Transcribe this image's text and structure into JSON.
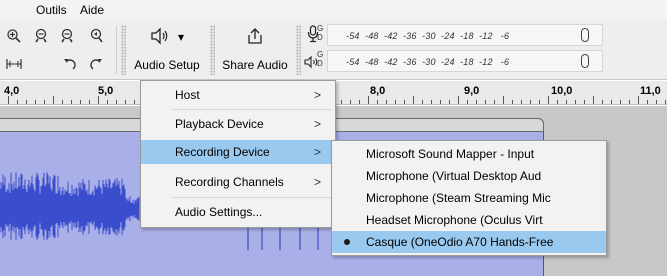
{
  "menubar": {
    "items": [
      {
        "label": "Outils"
      },
      {
        "label": "Aide"
      }
    ]
  },
  "toolbar": {
    "audio_setup_label": "Audio Setup",
    "share_audio_label": "Share Audio",
    "dropdown_glyph": "▾"
  },
  "meters": {
    "record": {
      "channels": "G\nD",
      "scale": "-54  -48  -42  -36  -30  -24  -18  -12   -6"
    },
    "playback": {
      "channels": "G\nD",
      "scale": "-54  -48  -42  -36  -30  -24  -18  -12   -6"
    }
  },
  "ruler": {
    "labels": [
      "4,0",
      "5,0",
      "8,0",
      "9,0",
      "10,0",
      "11,0"
    ]
  },
  "audio_setup_menu": {
    "items": [
      {
        "label": "Host",
        "submenu": true
      },
      {
        "label": "Playback Device",
        "submenu": true
      },
      {
        "label": "Recording Device",
        "submenu": true,
        "highlighted": true
      },
      {
        "label": "Recording Channels",
        "submenu": true
      },
      {
        "label": "Audio Settings...",
        "submenu": false
      }
    ],
    "arrow_glyph": ">"
  },
  "recording_device_menu": {
    "items": [
      {
        "label": "Microsoft Sound Mapper - Input",
        "selected": false
      },
      {
        "label": "Microphone (Virtual Desktop Aud",
        "selected": false
      },
      {
        "label": "Microphone (Steam Streaming Mic",
        "selected": false
      },
      {
        "label": "Headset Microphone (Oculus Virt",
        "selected": false
      },
      {
        "label": "Casque (OneOdio A70 Hands-Free",
        "selected": true
      }
    ]
  },
  "colors": {
    "highlight": "#99c9ef",
    "waveform": "#3a4dcc",
    "clip_background": "#a9b0e8",
    "track_background": "#c8c8c8"
  },
  "icons": [
    "zoom-in-icon",
    "zoom-out-icon",
    "zoom-selection-icon",
    "zoom-fit-icon",
    "zoom-toggle-icon",
    "undo-icon",
    "redo-icon",
    "speaker-icon",
    "share-icon",
    "microphone-icon"
  ]
}
